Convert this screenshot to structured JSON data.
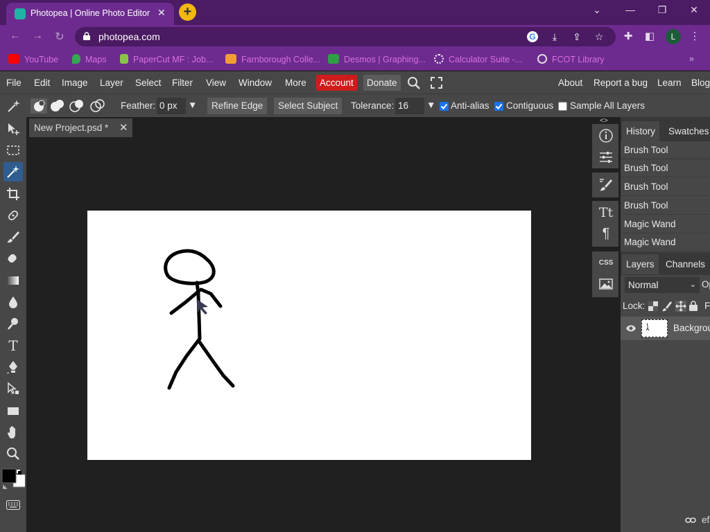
{
  "browser": {
    "tab_title": "Photopea | Online Photo Editor",
    "tab_close": "✕",
    "new_tab": "+",
    "url": "photopea.com",
    "profile_initial": "L",
    "window_controls": [
      "⌄",
      "—",
      "❐",
      "✕"
    ]
  },
  "bookmarks": [
    {
      "label": "YouTube",
      "icon": "youtube-icon",
      "color": "#ff0000"
    },
    {
      "label": "Maps",
      "icon": "maps-icon",
      "color": "#34a853"
    },
    {
      "label": "PaperCut MF : Job...",
      "icon": "papercut-icon",
      "color": "#8bc34a"
    },
    {
      "label": "Farnborough Colle...",
      "icon": "farnborough-icon",
      "color": "#f29d38"
    },
    {
      "label": "Desmos | Graphing...",
      "icon": "desmos-icon",
      "color": "#2f9e44"
    },
    {
      "label": "Calculator Suite -...",
      "icon": "calculator-icon",
      "color": "#ffffff"
    },
    {
      "label": "FCOT Library",
      "icon": "library-icon",
      "color": "#dddddd"
    }
  ],
  "menu": {
    "items": [
      "File",
      "Edit",
      "Image",
      "Layer",
      "Select",
      "Filter",
      "View",
      "Window",
      "More"
    ],
    "account": "Account",
    "donate": "Donate",
    "right_links": [
      "About",
      "Report a bug",
      "Learn",
      "Blog"
    ]
  },
  "options": {
    "feather_label": "Feather:",
    "feather_value": "0 px",
    "refine_edge": "Refine Edge",
    "select_subject": "Select Subject",
    "tolerance_label": "Tolerance:",
    "tolerance_value": "16",
    "anti_alias": "Anti-alias",
    "anti_alias_checked": true,
    "contiguous": "Contiguous",
    "contiguous_checked": true,
    "sample_all_layers": "Sample All Layers",
    "sample_all_layers_checked": false
  },
  "document": {
    "tab_name": "New Project.psd *",
    "tab_close": "✕"
  },
  "history": {
    "tabs": [
      "History",
      "Swatches"
    ],
    "items": [
      "Brush Tool",
      "Brush Tool",
      "Brush Tool",
      "Brush Tool",
      "Magic Wand",
      "Magic Wand"
    ]
  },
  "layers": {
    "tabs": [
      "Layers",
      "Channels"
    ],
    "blend_mode": "Normal",
    "opacity_label_partial": "Op",
    "lock_label": "Lock:",
    "fill_label_partial": "F",
    "layer_name": "Backgrou",
    "bottom_partial": "ef"
  },
  "mini_panel": {
    "collapse_arrows": "<>"
  },
  "colors": {
    "accent_active_tool": "#2f5d8f",
    "account_red": "#cf1b1b",
    "chrome_purple": "#6d2b8f"
  }
}
